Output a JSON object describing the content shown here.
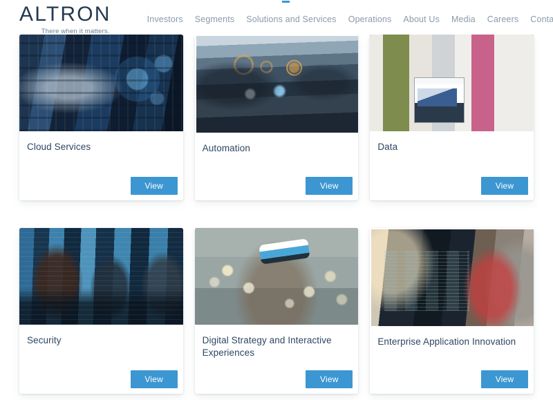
{
  "header": {
    "logo": {
      "wordmark": "ALTRON",
      "tagline": "There when it matters.",
      "accent_color": "#3c96d2",
      "text_color": "#24394f"
    },
    "nav": [
      {
        "label": "Investors"
      },
      {
        "label": "Segments"
      },
      {
        "label": "Solutions and Services"
      },
      {
        "label": "Operations"
      },
      {
        "label": "About Us"
      },
      {
        "label": "Media"
      },
      {
        "label": "Careers"
      },
      {
        "label": "Contact Us"
      }
    ]
  },
  "cards": [
    {
      "title": "Cloud Services",
      "button_label": "View",
      "image_alt": "Two colleagues with a laptop in a blue-lit data centre with glowing cloud icons"
    },
    {
      "title": "Automation",
      "button_label": "View",
      "image_alt": "Car interior dashboard with augmented-reality sensor overlays"
    },
    {
      "title": "Data",
      "button_label": "View",
      "image_alt": "Office colleagues around a monitor displaying an analytics chart"
    },
    {
      "title": "Security",
      "button_label": "View",
      "image_alt": "Security operations centre with analysts at banks of blue monitors"
    },
    {
      "title": "Digital Strategy and Interactive Experiences",
      "button_label": "View",
      "image_alt": "Woman wearing a virtual reality headset amid bokeh lights"
    },
    {
      "title": "Enterprise Application Innovation",
      "button_label": "View",
      "image_alt": "Developers reviewing code on dark monitors in a bright office"
    }
  ],
  "theme": {
    "accent_blue": "#3c96d2",
    "title_navy": "#2d4663",
    "nav_grey": "#8b9aab",
    "page_background": "#ffffff"
  }
}
